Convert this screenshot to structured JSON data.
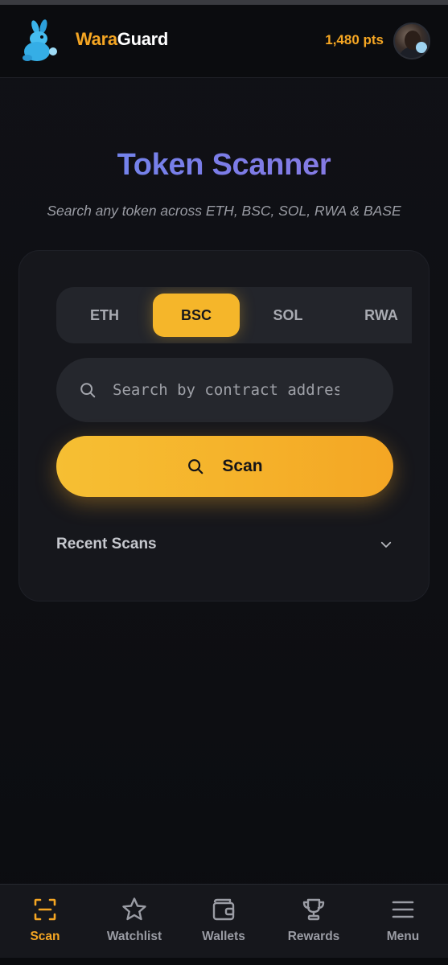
{
  "header": {
    "brand_part1": "Wara",
    "brand_part2": "Guard",
    "points": "1,480 pts",
    "logo_icon": "rabbit-logo-icon",
    "avatar_icon": "user-avatar"
  },
  "hero": {
    "title": "Token Scanner",
    "subtitle": "Search any token across ETH, BSC, SOL, RWA & BASE"
  },
  "scanner": {
    "tabs": [
      {
        "label": "ETH",
        "active": false
      },
      {
        "label": "BSC",
        "active": true
      },
      {
        "label": "SOL",
        "active": false
      },
      {
        "label": "RWA",
        "active": false
      }
    ],
    "search_placeholder": "Search by contract address",
    "search_value": "",
    "scan_label": "Scan",
    "recent_label": "Recent Scans"
  },
  "nav": {
    "items": [
      {
        "label": "Scan",
        "icon": "scan-icon",
        "active": true
      },
      {
        "label": "Watchlist",
        "icon": "star-icon",
        "active": false
      },
      {
        "label": "Wallets",
        "icon": "wallet-icon",
        "active": false
      },
      {
        "label": "Rewards",
        "icon": "trophy-icon",
        "active": false
      },
      {
        "label": "Menu",
        "icon": "menu-icon",
        "active": false
      }
    ]
  },
  "colors": {
    "accent": "#f5a623",
    "title_gradient_start": "#6b8cf0",
    "title_gradient_end": "#8f79e0",
    "background": "#0d0e12",
    "card": "#16171c"
  }
}
